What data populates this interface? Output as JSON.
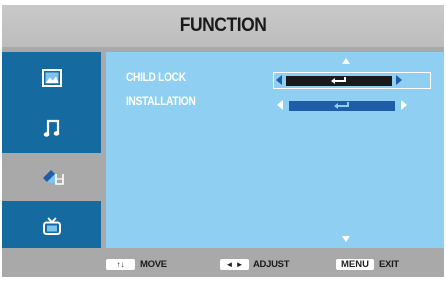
{
  "menu": {
    "title": "FUNCTION",
    "sidebar": {
      "items": [
        {
          "icon": "picture-icon",
          "label": ""
        },
        {
          "icon": "music-note-icon",
          "label": ""
        },
        {
          "icon": "function-icon",
          "label": "",
          "selected": true
        },
        {
          "icon": "tv-icon",
          "label": ""
        }
      ]
    },
    "rows": [
      {
        "label": "CHILD LOCK",
        "value_icon": "enter-icon",
        "selected": true
      },
      {
        "label": "INSTALLATION",
        "value_icon": "enter-icon",
        "selected": false
      }
    ],
    "scroll": {
      "up_icon": "scroll-up-arrow-icon",
      "down_icon": "scroll-down-arrow-icon"
    }
  },
  "footer": {
    "move": {
      "key": "↑↓",
      "label": "MOVE"
    },
    "adjust": {
      "key": "◄ ►",
      "label": "ADJUST"
    },
    "exit": {
      "key": "MENU",
      "label": "EXIT"
    }
  },
  "colors": {
    "frame": "#a9a9a9",
    "sidebar": "#156aa0",
    "panel": "#8fcff1",
    "bar_selected": "#1a1a1a",
    "bar_unselected": "#1f5da8",
    "arrow_unselected": "#ffffff"
  }
}
